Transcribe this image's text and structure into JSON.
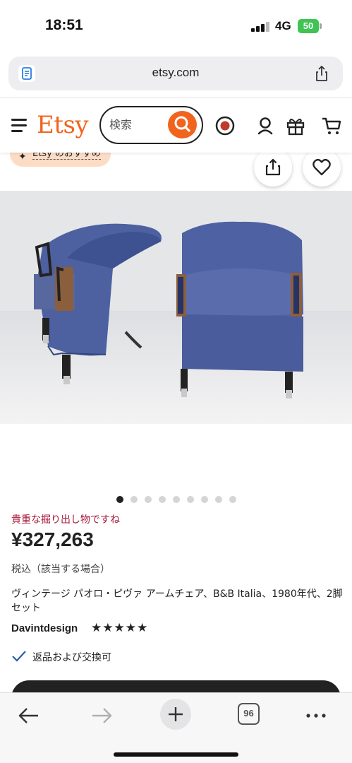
{
  "status_bar": {
    "time": "18:51",
    "network": "4G",
    "battery": "50"
  },
  "browser": {
    "url": "etsy.com",
    "tabs_count": "96"
  },
  "header": {
    "logo": "Etsy",
    "search_placeholder": "検索",
    "accent_color": "#f1641e"
  },
  "badge": {
    "label": "Etsy のおすすめ"
  },
  "carousel": {
    "total": 9,
    "active_index": 0
  },
  "product": {
    "promo": "貴重な掘り出し物ですね",
    "price": "¥327,263",
    "tax_note": "税込（該当する場合）",
    "title": "ヴィンテージ パオロ・ピヴァ アームチェア、B&B Italia、1980年代、2脚セット",
    "shop": "Davintdesign",
    "rating_stars": "★★★★★",
    "rating": 5,
    "returns": "返品および交換可"
  },
  "colors": {
    "promo": "#a61a3c",
    "chair_fabric": "#4d60a0"
  }
}
